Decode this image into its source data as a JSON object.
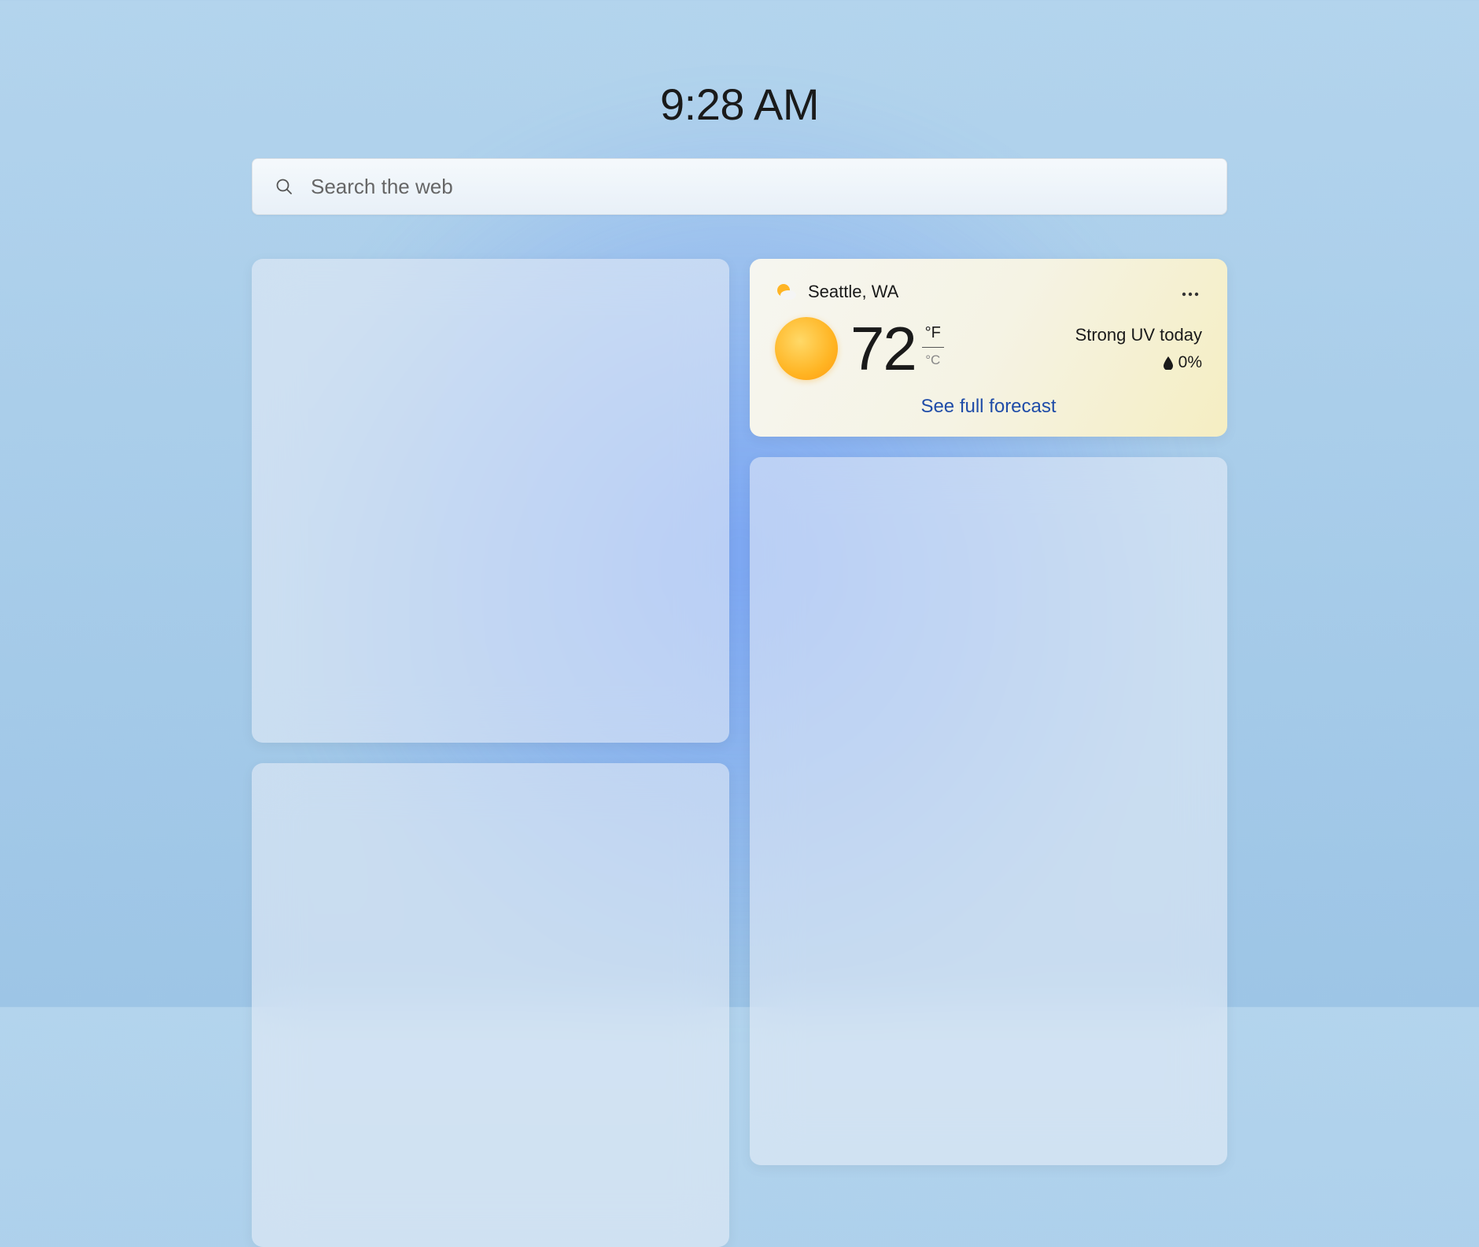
{
  "header": {
    "time": "9:28 AM"
  },
  "search": {
    "placeholder": "Search the web"
  },
  "weather": {
    "location": "Seattle, WA",
    "temperature": "72",
    "unit_f": "°F",
    "unit_c": "°C",
    "condition_icon": "sun",
    "uv_text": "Strong UV today",
    "precip_pct": "0%",
    "forecast_link": "See full forecast"
  }
}
